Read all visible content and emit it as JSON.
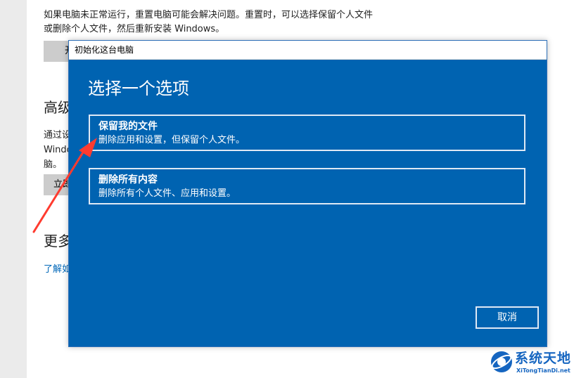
{
  "background": {
    "description": "如果电脑未正常运行，重置电脑可能会解决问题。重置时，可以选择保留个人文件或删除个人文件，然后重新安装 Windows。",
    "reset_button": "开",
    "advanced_heading": "高级",
    "advanced_desc_line1": "通过设",
    "advanced_desc_line2": "Windo",
    "advanced_desc_line3": "脑。",
    "restart_button": "立即",
    "more_heading": "更多",
    "learn_link": "了解如"
  },
  "dialog": {
    "title": "初始化这台电脑",
    "heading": "选择一个选项",
    "options": [
      {
        "title": "保留我的文件",
        "desc": "删除应用和设置，但保留个人文件。"
      },
      {
        "title": "删除所有内容",
        "desc": "删除所有个人文件、应用和设置。"
      }
    ],
    "cancel": "取消"
  },
  "watermark": {
    "brand": "系统天地",
    "url": "XiTongTianDi.net"
  },
  "colors": {
    "dialog_bg": "#0063b1",
    "annotation_arrow": "#ff3b2f",
    "watermark": "#1565c0"
  },
  "icons": [
    "annotation-arrow",
    "watermark-logo"
  ]
}
